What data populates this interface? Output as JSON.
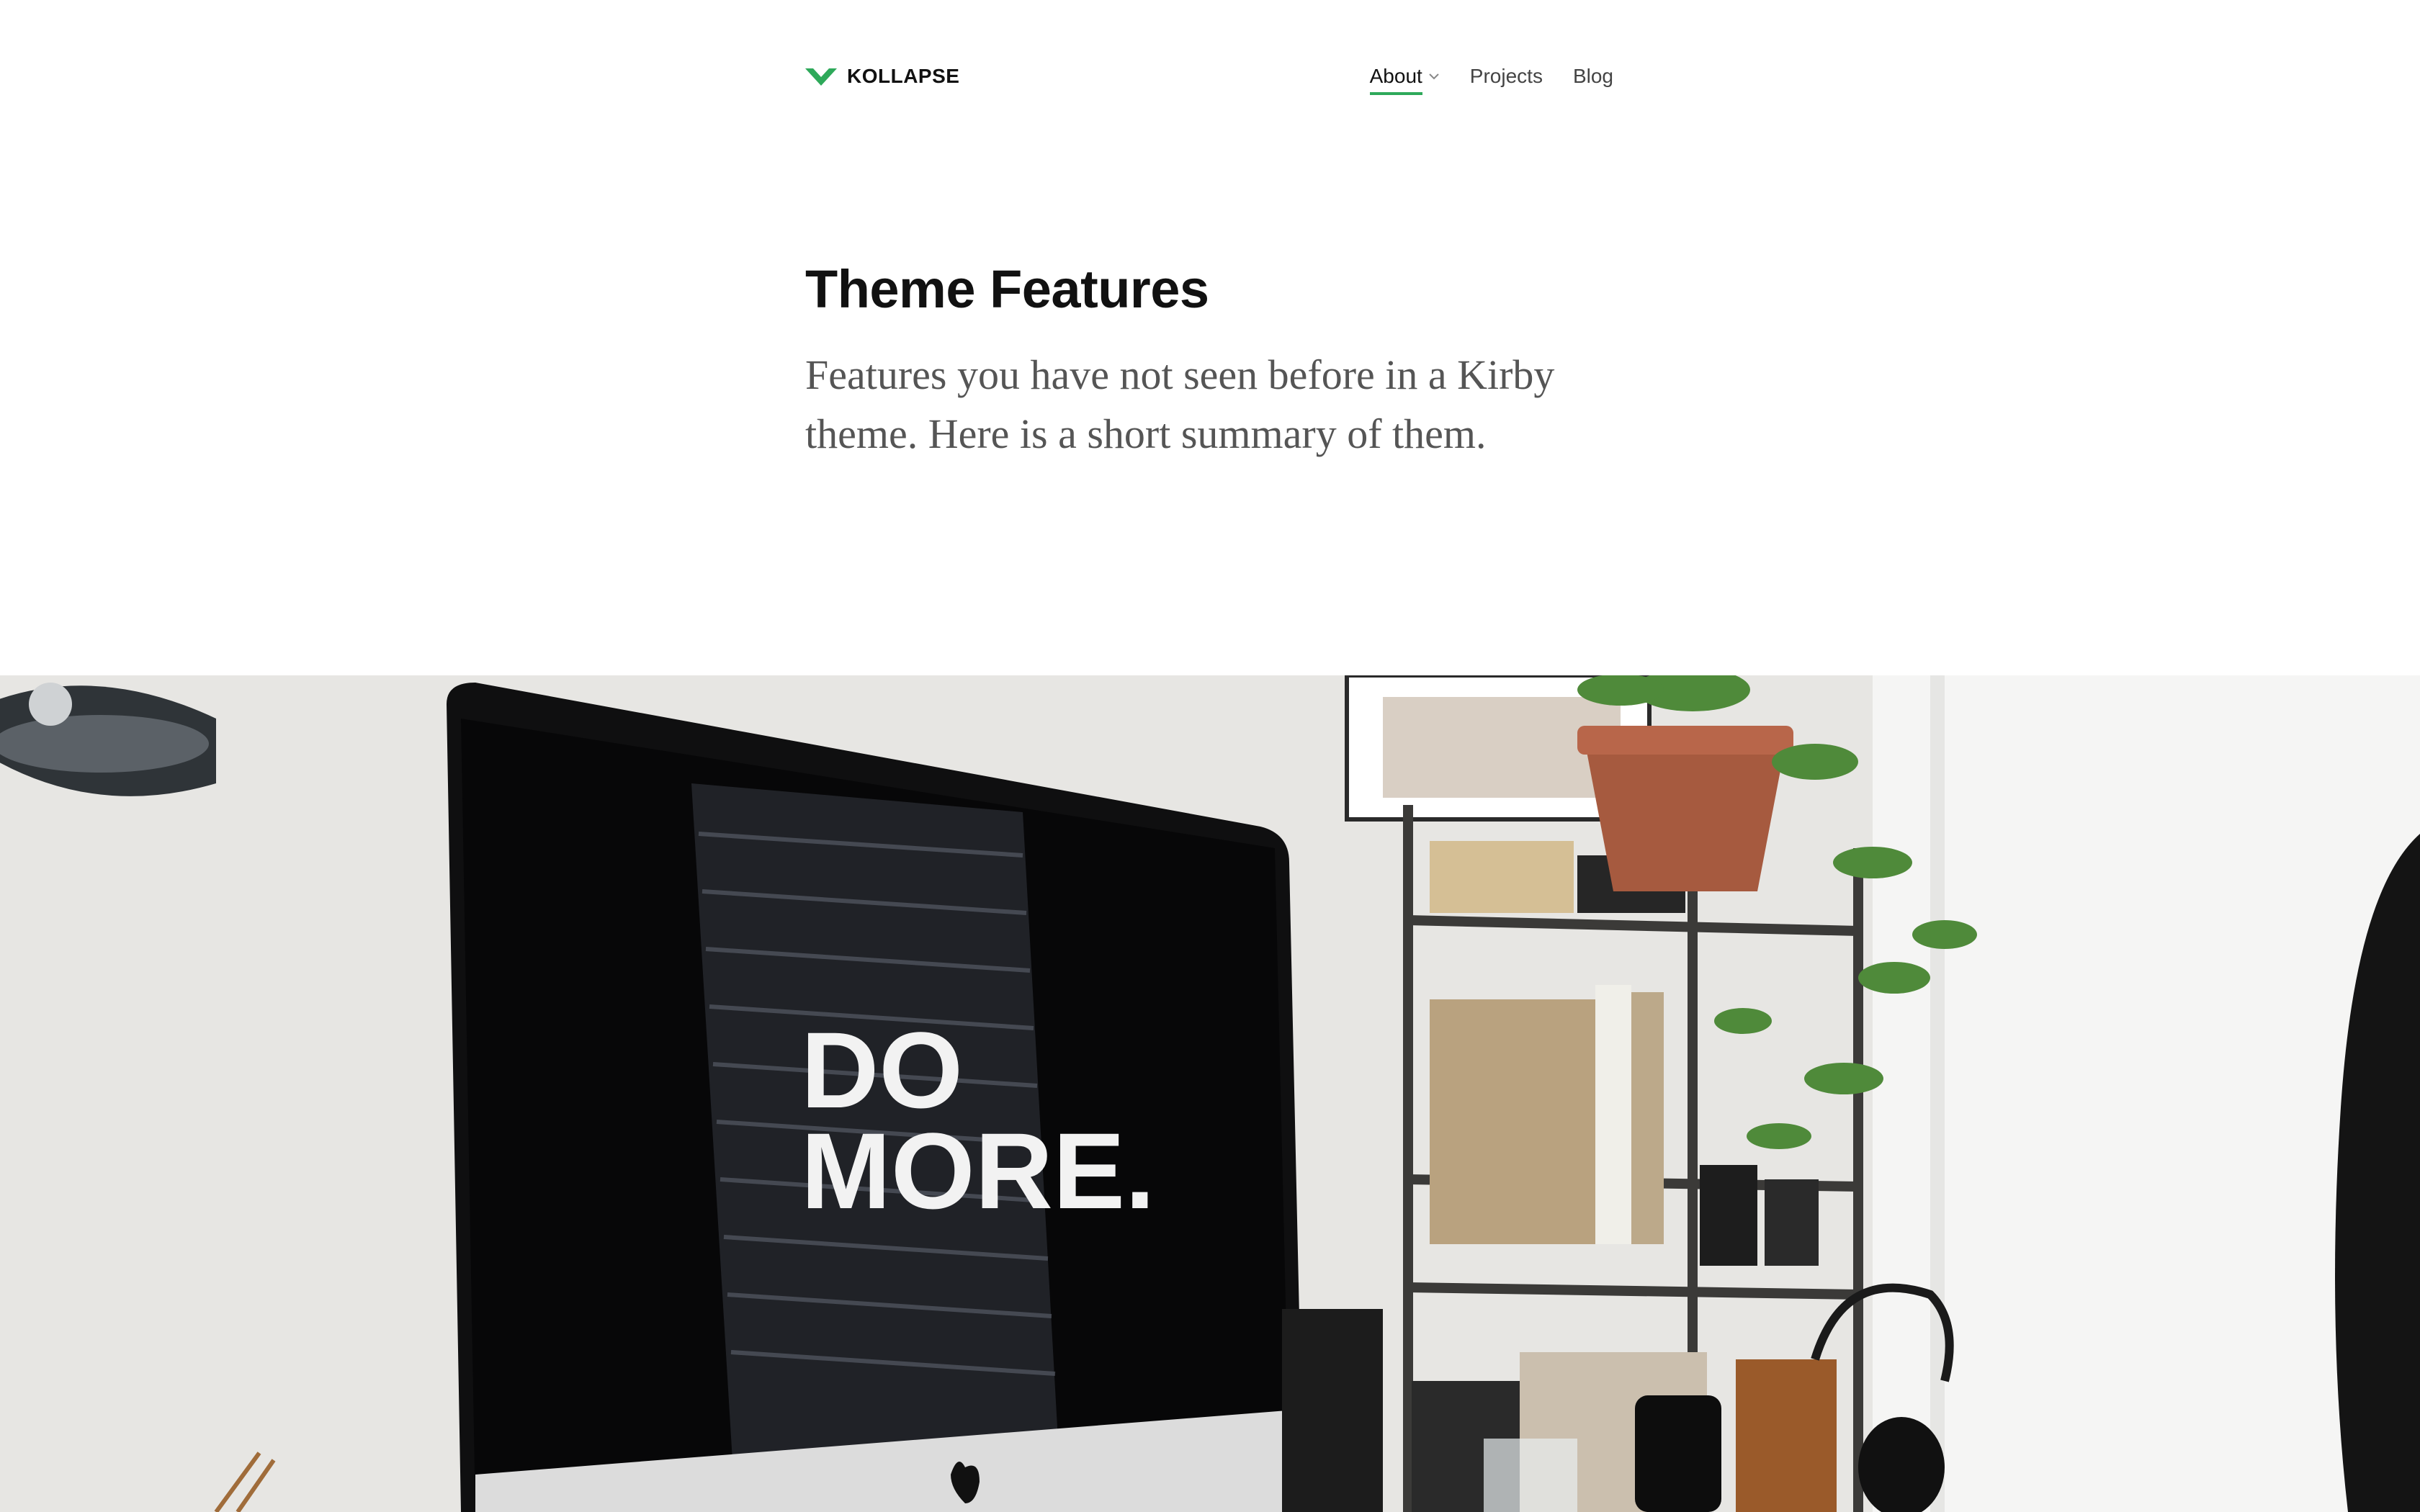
{
  "brand": {
    "name": "KOLLAPSE",
    "accent_color": "#2ea95a",
    "logo_icon": "chevron-v-logo-icon"
  },
  "nav": {
    "items": [
      {
        "label": "About",
        "active": true,
        "has_dropdown": true
      },
      {
        "label": "Projects",
        "active": false,
        "has_dropdown": false
      },
      {
        "label": "Blog",
        "active": false,
        "has_dropdown": false
      }
    ]
  },
  "hero": {
    "title": "Theme Features",
    "subtitle": "Features you have not seen before in a Kirby theme. Here is a short summary of them."
  },
  "photo": {
    "screen_text": [
      "DO",
      "MORE."
    ]
  }
}
